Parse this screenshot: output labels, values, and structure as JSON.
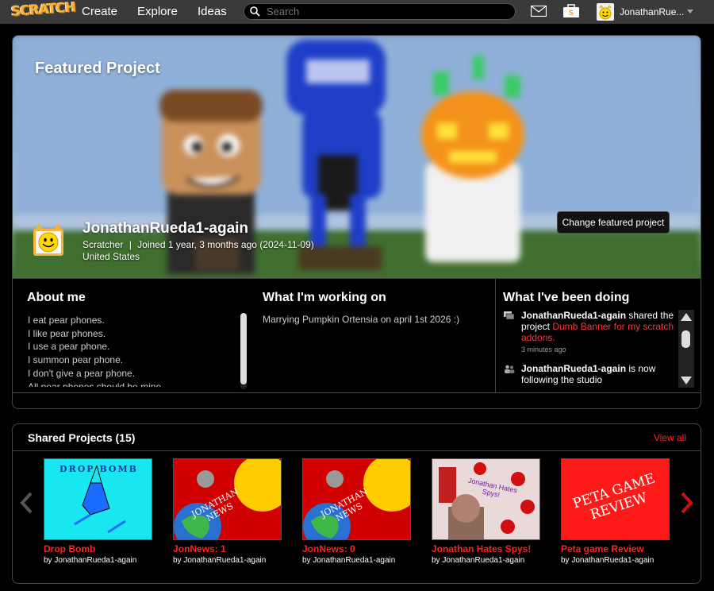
{
  "nav": {
    "logo": "SCRATCH",
    "create": "Create",
    "explore": "Explore",
    "ideas": "Ideas",
    "search_placeholder": "Search",
    "username": "JonathanRue..."
  },
  "profile": {
    "featured_title": "Featured Project",
    "username": "JonathanRueda1-again",
    "role": "Scratcher",
    "joined": "Joined 1 year, 3 months ago (2024-11-09)",
    "country": "United States",
    "change_button": "Change featured project"
  },
  "about": {
    "title": "About me",
    "lines": [
      "I eat pear phones.",
      "I like pear phones.",
      "I use a pear phone.",
      "I summon pear phone.",
      "I don't give a pear phone.",
      "All pear phones should be mine"
    ]
  },
  "working": {
    "title": "What I'm working on",
    "text": "Marrying Pumpkin Ortensia on april 1st 2026 :)"
  },
  "doing": {
    "title": "What I've been doing",
    "items": [
      {
        "user": "JonathanRueda1-again",
        "action": "shared the project",
        "link": "Dumb Banner for my scratch addons.",
        "time": "3 minutes ago"
      },
      {
        "user": "JonathanRueda1-again",
        "action": "is now following the studio",
        "link": "",
        "time": ""
      }
    ]
  },
  "shared": {
    "title": "Shared Projects (15)",
    "view_all": "View all",
    "projects": [
      {
        "title": "Drop Bomb",
        "by": "by JonathanRueda1-again",
        "thumb_text": "DROP BOMB"
      },
      {
        "title": "JonNews: 1",
        "by": "by JonathanRueda1-again",
        "thumb_text": "JONATHAN NEWS"
      },
      {
        "title": "JonNews: 0",
        "by": "by JonathanRueda1-again",
        "thumb_text": "JONATHAN NEWS"
      },
      {
        "title": "Jonathan Hates Spys!",
        "by": "by JonathanRueda1-again",
        "thumb_text": "Jonathan Hates Spys!"
      },
      {
        "title": "Peta game Review",
        "by": "by JonathanRueda1-again",
        "thumb_text": "PETA GAME REVIEW"
      }
    ]
  },
  "colors": {
    "accent_red": "#ff2222",
    "navbar": "#3a3a3a",
    "logo_orange": "#f7b23a"
  }
}
